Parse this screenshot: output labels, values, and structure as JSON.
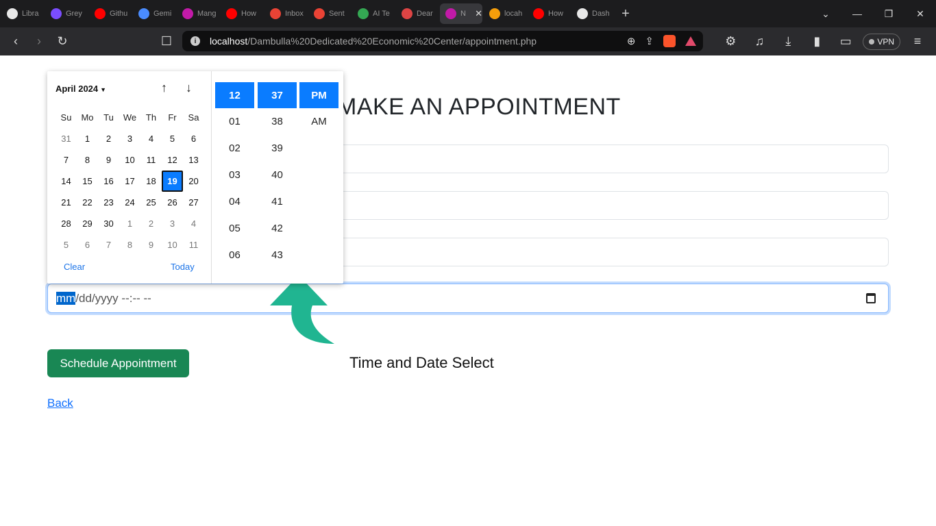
{
  "browser": {
    "tabs": [
      {
        "label": "Libra",
        "color": "#e8e8e8"
      },
      {
        "label": "Grey",
        "color": "#7b4dff"
      },
      {
        "label": "Githu",
        "color": "#ff0000"
      },
      {
        "label": "Gemi",
        "color": "#4a8cff"
      },
      {
        "label": "Mang",
        "color": "#c21aa8"
      },
      {
        "label": "How",
        "color": "#ff0000"
      },
      {
        "label": "Inbox",
        "color": "#ea4335"
      },
      {
        "label": "Sent",
        "color": "#ea4335"
      },
      {
        "label": "AI Te",
        "color": "#34a853"
      },
      {
        "label": "Dear",
        "color": "#d44"
      },
      {
        "label": "N",
        "color": "#c21aa8"
      },
      {
        "label": "locah",
        "color": "#f59e0b"
      },
      {
        "label": "How",
        "color": "#ff0000"
      },
      {
        "label": "Dash",
        "color": "#e8e8e8"
      }
    ],
    "url_host": "localhost",
    "url_path": "/Dambulla%20Dedicated%20Economic%20Center/appointment.php",
    "vpn_label": "VPN"
  },
  "page": {
    "title": "MAKE AN APPOINTMENT",
    "datetime_segment": "mm",
    "datetime_rest": "/dd/yyyy --:-- --",
    "submit_label": "Schedule Appointment",
    "back_label": "Back",
    "annotation": "Time and Date Select"
  },
  "picker": {
    "month_label": "April 2024",
    "weekdays": [
      "Su",
      "Mo",
      "Tu",
      "We",
      "Th",
      "Fr",
      "Sa"
    ],
    "days": [
      {
        "d": "31",
        "o": true
      },
      {
        "d": "1"
      },
      {
        "d": "2"
      },
      {
        "d": "3"
      },
      {
        "d": "4"
      },
      {
        "d": "5"
      },
      {
        "d": "6"
      },
      {
        "d": "7"
      },
      {
        "d": "8"
      },
      {
        "d": "9"
      },
      {
        "d": "10"
      },
      {
        "d": "11"
      },
      {
        "d": "12"
      },
      {
        "d": "13"
      },
      {
        "d": "14"
      },
      {
        "d": "15"
      },
      {
        "d": "16"
      },
      {
        "d": "17"
      },
      {
        "d": "18"
      },
      {
        "d": "19",
        "s": true
      },
      {
        "d": "20"
      },
      {
        "d": "21"
      },
      {
        "d": "22"
      },
      {
        "d": "23"
      },
      {
        "d": "24"
      },
      {
        "d": "25"
      },
      {
        "d": "26"
      },
      {
        "d": "27"
      },
      {
        "d": "28"
      },
      {
        "d": "29"
      },
      {
        "d": "30"
      },
      {
        "d": "1",
        "o": true
      },
      {
        "d": "2",
        "o": true
      },
      {
        "d": "3",
        "o": true
      },
      {
        "d": "4",
        "o": true
      },
      {
        "d": "5",
        "o": true
      },
      {
        "d": "6",
        "o": true
      },
      {
        "d": "7",
        "o": true
      },
      {
        "d": "8",
        "o": true
      },
      {
        "d": "9",
        "o": true
      },
      {
        "d": "10",
        "o": true
      },
      {
        "d": "11",
        "o": true
      }
    ],
    "clear_label": "Clear",
    "today_label": "Today",
    "hour_selected": "12",
    "hours": [
      "01",
      "02",
      "03",
      "04",
      "05",
      "06"
    ],
    "minute_selected": "37",
    "minutes": [
      "38",
      "39",
      "40",
      "41",
      "42",
      "43"
    ],
    "ampm_selected": "PM",
    "ampm_options": [
      "AM"
    ]
  }
}
